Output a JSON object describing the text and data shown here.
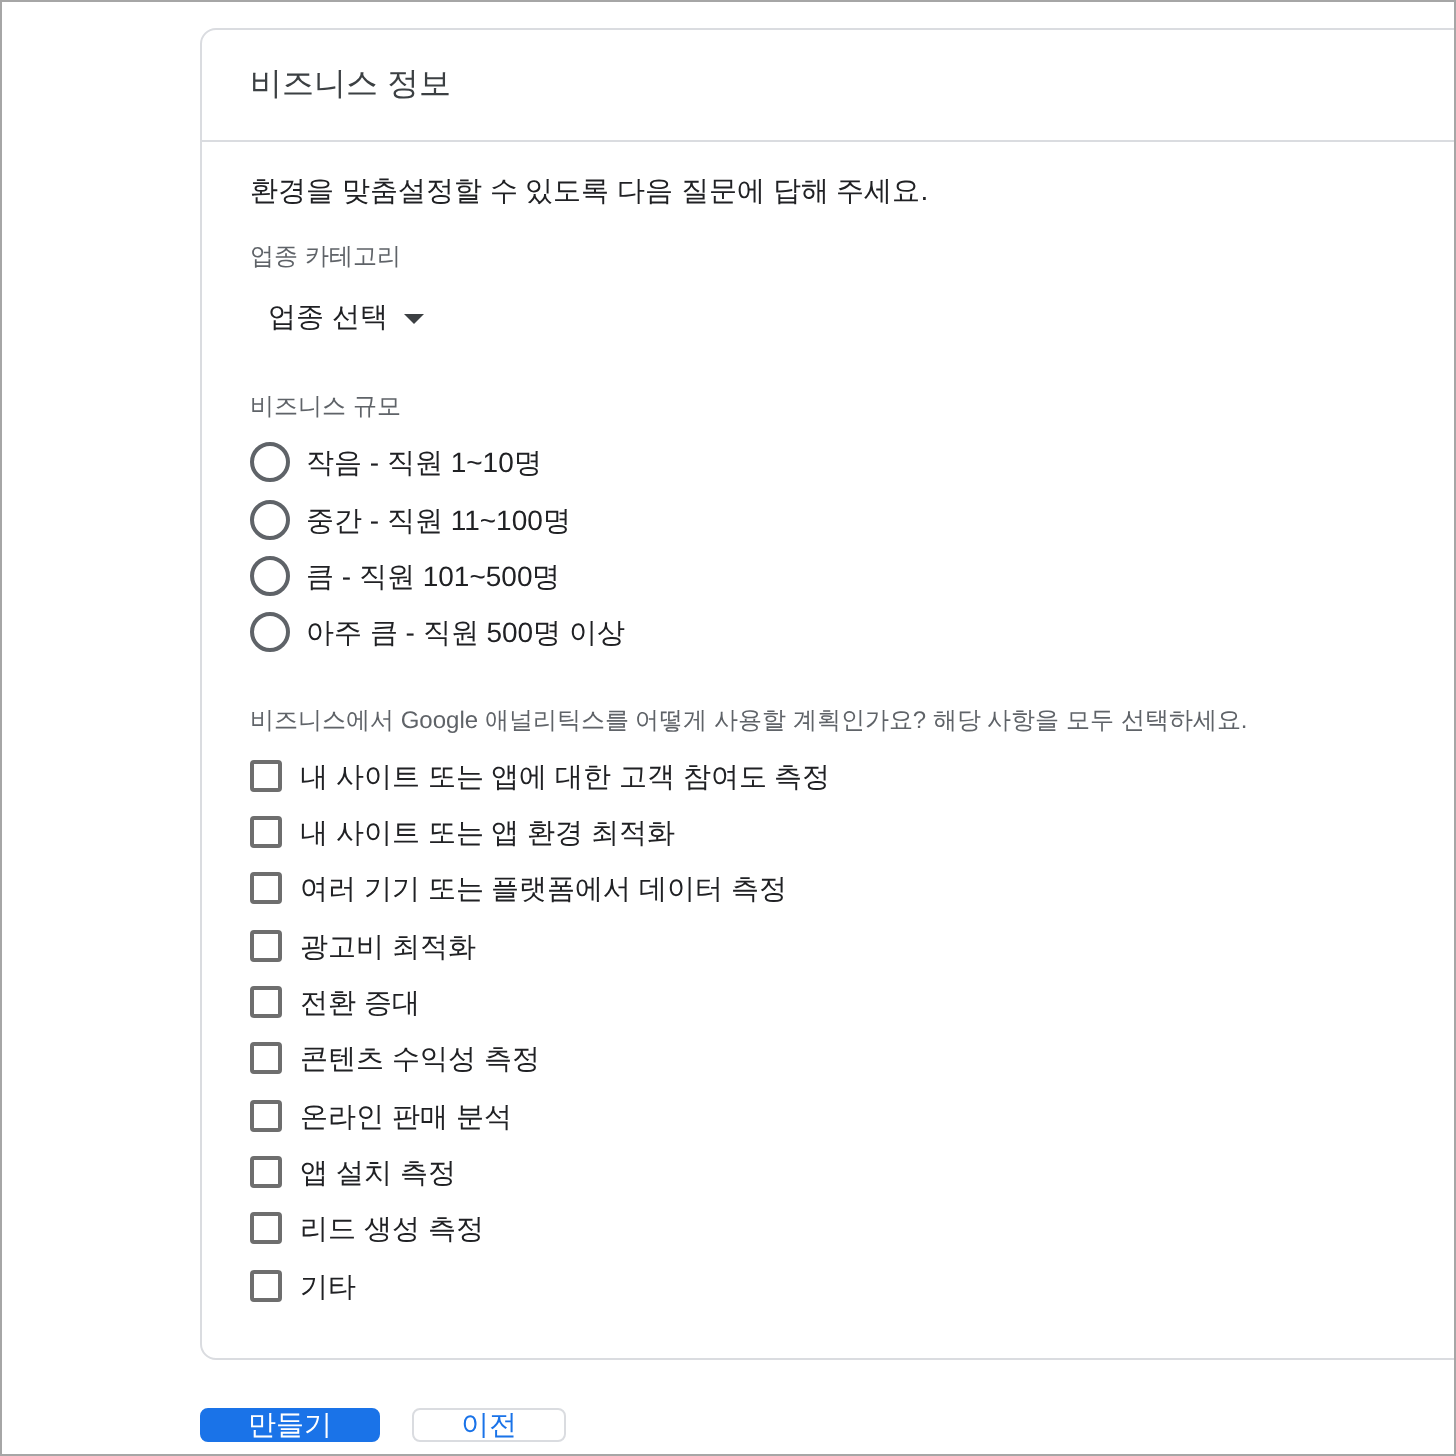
{
  "card": {
    "title": "비즈니스 정보",
    "intro": "환경을 맞춤설정할 수 있도록 다음 질문에 답해 주세요.",
    "industry": {
      "label": "업종 카테고리",
      "dropdown": {
        "value": "업종 선택"
      }
    },
    "business_size": {
      "label": "비즈니스 규모",
      "options": [
        {
          "label": "작음 - 직원 1~10명",
          "selected": false
        },
        {
          "label": "중간 - 직원 11~100명",
          "selected": false
        },
        {
          "label": "큼 - 직원 101~500명",
          "selected": false
        },
        {
          "label": "아주 큼 - 직원 500명 이상",
          "selected": false
        }
      ]
    },
    "usage": {
      "label": "비즈니스에서 Google 애널리틱스를 어떻게 사용할 계획인가요? 해당 사항을 모두 선택하세요.",
      "options": [
        {
          "label": "내 사이트 또는 앱에 대한 고객 참여도 측정",
          "checked": false
        },
        {
          "label": "내 사이트 또는 앱 환경 최적화",
          "checked": false
        },
        {
          "label": "여러 기기 또는 플랫폼에서 데이터 측정",
          "checked": false
        },
        {
          "label": "광고비 최적화",
          "checked": false
        },
        {
          "label": "전환 증대",
          "checked": false
        },
        {
          "label": "콘텐츠 수익성 측정",
          "checked": false
        },
        {
          "label": "온라인 판매 분석",
          "checked": false
        },
        {
          "label": "앱 설치 측정",
          "checked": false
        },
        {
          "label": "리드 생성 측정",
          "checked": false
        },
        {
          "label": "기타",
          "checked": false
        }
      ]
    }
  },
  "buttons": [
    {
      "label": "만들기",
      "kind": "primary"
    },
    {
      "label": "이전",
      "kind": "secondary"
    }
  ]
}
